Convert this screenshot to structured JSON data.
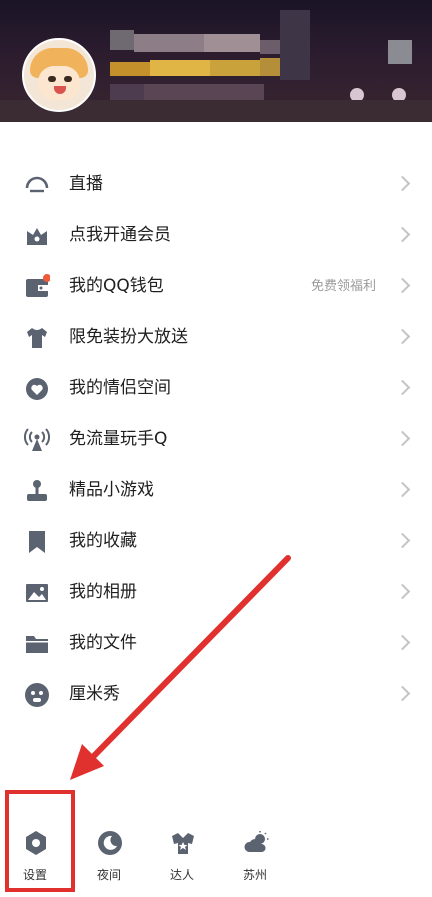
{
  "header": {
    "avatar_alt": "",
    "nickname_blurred": ""
  },
  "menu": {
    "items": [
      {
        "icon": "live-icon",
        "label": "直播"
      },
      {
        "icon": "crown-icon",
        "label": "点我开通会员"
      },
      {
        "icon": "wallet-icon",
        "label": "我的QQ钱包",
        "extra": "免费领福利",
        "badge": true
      },
      {
        "icon": "shirt-icon",
        "label": "限免装扮大放送"
      },
      {
        "icon": "heart-icon",
        "label": "我的情侣空间"
      },
      {
        "icon": "signal-icon",
        "label": "免流量玩手Q"
      },
      {
        "icon": "joystick-icon",
        "label": "精品小游戏"
      },
      {
        "icon": "bookmark-icon",
        "label": "我的收藏"
      },
      {
        "icon": "photo-icon",
        "label": "我的相册"
      },
      {
        "icon": "folder-icon",
        "label": "我的文件"
      },
      {
        "icon": "avatar-show-icon",
        "label": "厘米秀"
      }
    ]
  },
  "bottom": {
    "settings": "设置",
    "night": "夜间",
    "expert": "达人",
    "weather_city": "苏州"
  },
  "colors": {
    "icon": "#5b6270",
    "badge": "#f05a3c",
    "highlight": "#e0312f"
  }
}
